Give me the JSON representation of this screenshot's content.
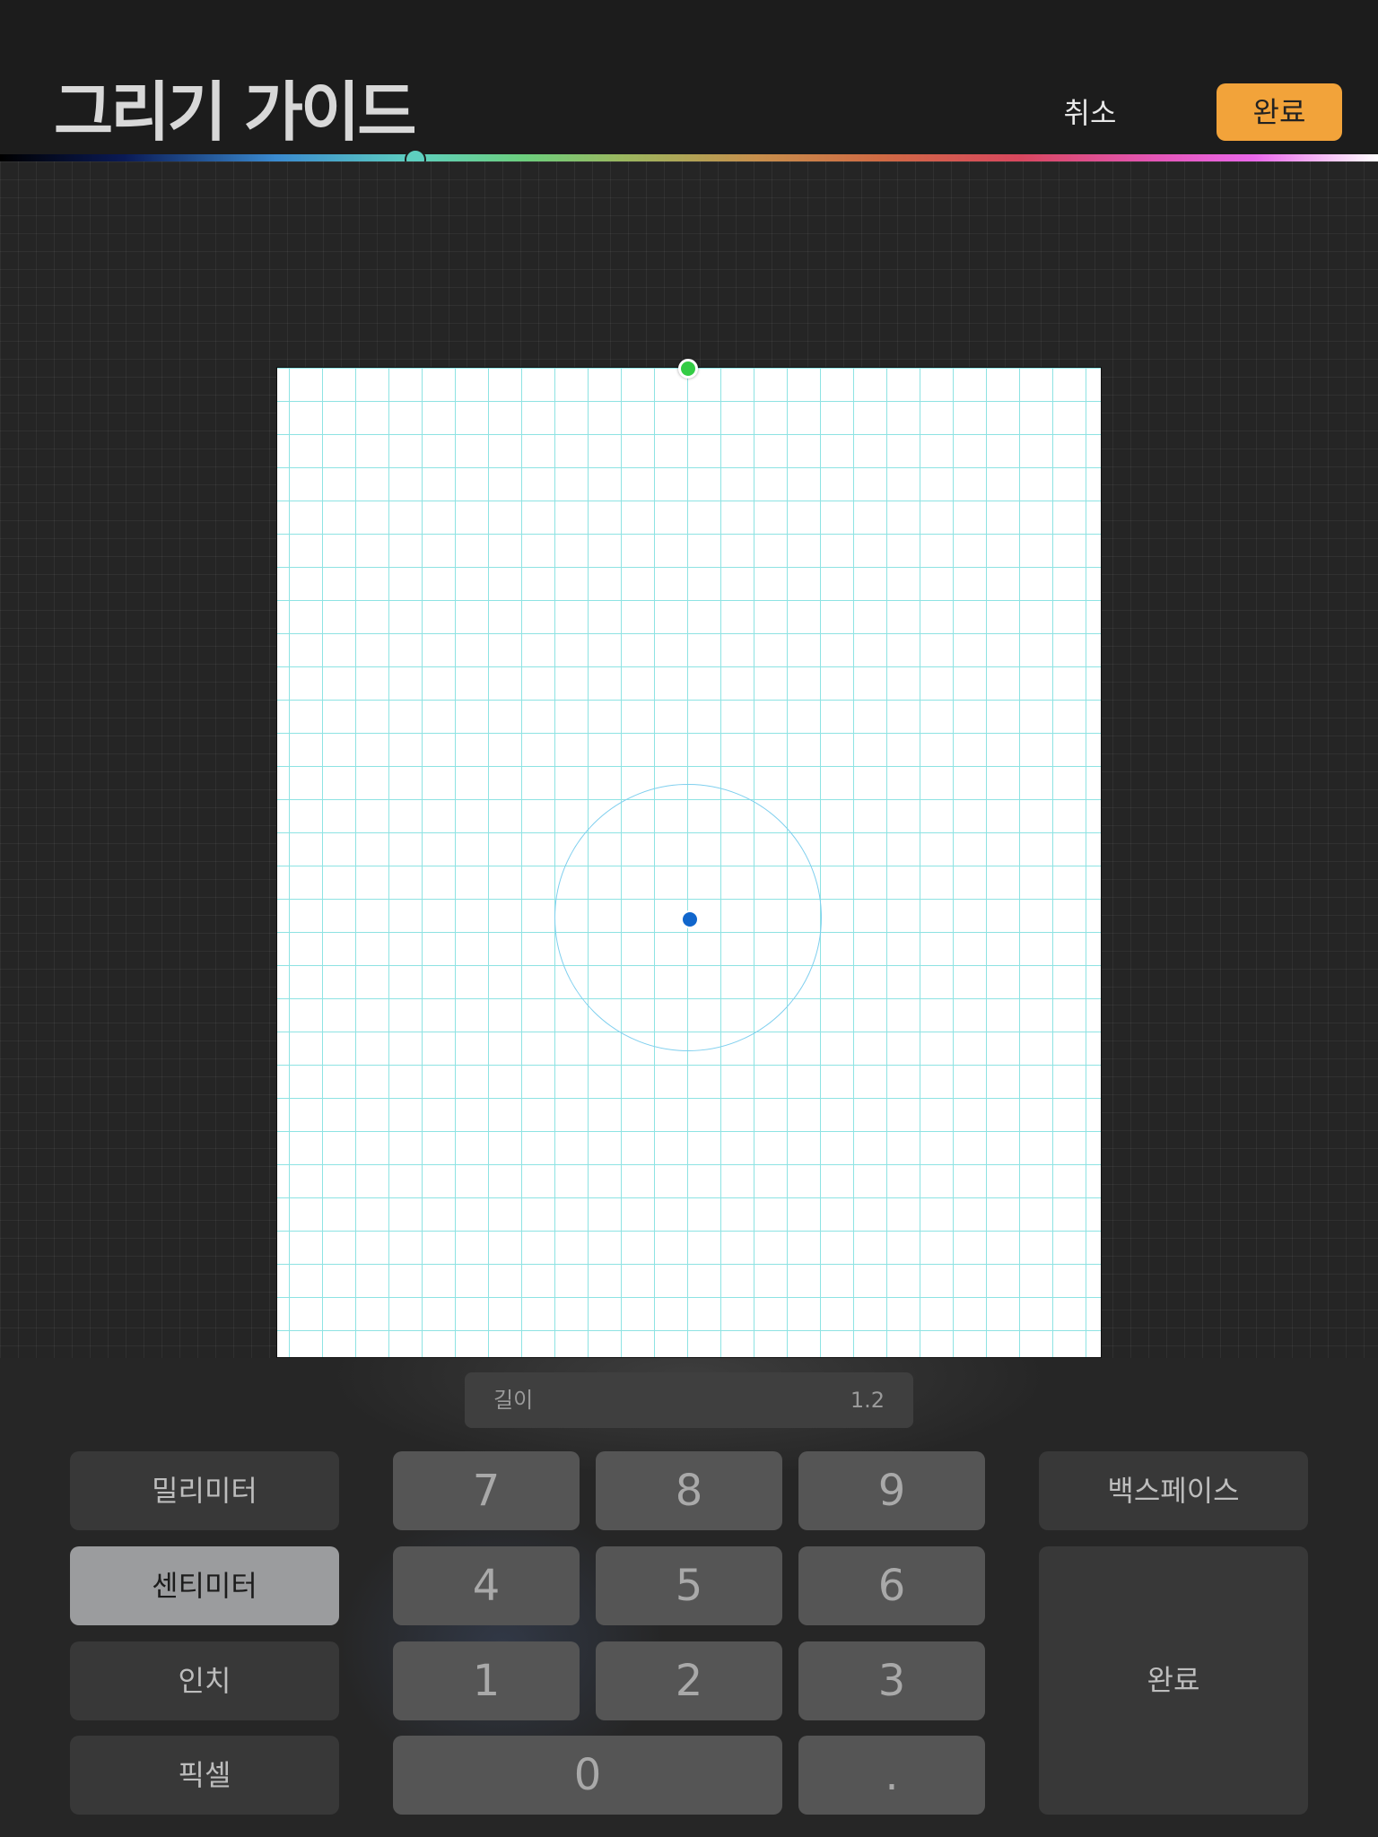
{
  "header": {
    "title": "그리기 가이드",
    "cancel_label": "취소",
    "done_label": "완료"
  },
  "color_slider": {
    "position": 0.3
  },
  "keypad": {
    "length_label": "길이",
    "length_value": "1.2",
    "units": [
      "밀리미터",
      "센티미터",
      "인치",
      "픽셀"
    ],
    "active_unit": "센티미터",
    "keys": {
      "k7": "7",
      "k8": "8",
      "k9": "9",
      "k4": "4",
      "k5": "5",
      "k6": "6",
      "k1": "1",
      "k2": "2",
      "k3": "3",
      "k0": "0",
      "dot": "."
    },
    "backspace_label": "백스페이스",
    "done_label": "완료"
  },
  "colors": {
    "accent": "#f2a33a",
    "grid": "#8ee3e3",
    "center_handle": "#1166cc",
    "rotate_handle": "#33cc44"
  }
}
